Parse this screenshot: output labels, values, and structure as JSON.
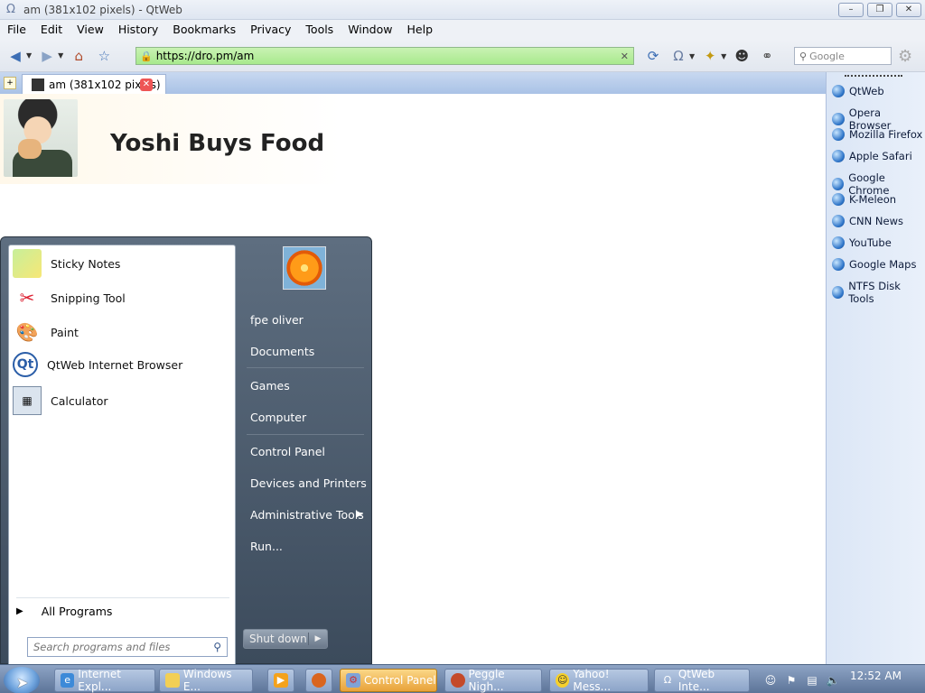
{
  "window": {
    "title": "am (381x102 pixels) - QtWeb",
    "minimize_label": "–",
    "restore_label": "❐",
    "close_label": "✕"
  },
  "menubar": {
    "items": [
      "File",
      "Edit",
      "View",
      "History",
      "Bookmarks",
      "Privacy",
      "Tools",
      "Window",
      "Help"
    ]
  },
  "toolbar": {
    "url": "https://dro.pm/am",
    "search_placeholder": "Google"
  },
  "tabs": [
    {
      "label": "am (381x102 pixels)"
    }
  ],
  "page": {
    "title": "Yoshi Buys Food"
  },
  "sidebar": {
    "items": [
      "QtWeb",
      "Opera Browser",
      "Mozilla Firefox",
      "Apple Safari",
      "Google Chrome",
      "K-Meleon",
      "CNN News",
      "YouTube",
      "Google Maps",
      "NTFS Disk Tools"
    ]
  },
  "start_menu": {
    "programs": [
      "Sticky Notes",
      "Snipping Tool",
      "Paint",
      "QtWeb Internet Browser",
      "Calculator"
    ],
    "all_programs": "All Programs",
    "search_placeholder": "Search programs and files",
    "user": "fpe oliver",
    "links": [
      "Documents",
      "Games",
      "Computer",
      "Control Panel",
      "Devices and Printers",
      "Administrative Tools",
      "Run..."
    ],
    "shutdown": "Shut down"
  },
  "taskbar": {
    "tasks": [
      "Internet Expl...",
      "Windows E...",
      "",
      "",
      "Control Panel",
      "Peggle Nigh...",
      "Yahoo! Mess...",
      "QtWeb Inte..."
    ],
    "active_task": "Control Panel",
    "clock": "12:52 AM"
  },
  "colors": {
    "url_bar": "#a8e98d",
    "active_task": "#e8a23a",
    "start_menu": "#3c4b5c"
  }
}
